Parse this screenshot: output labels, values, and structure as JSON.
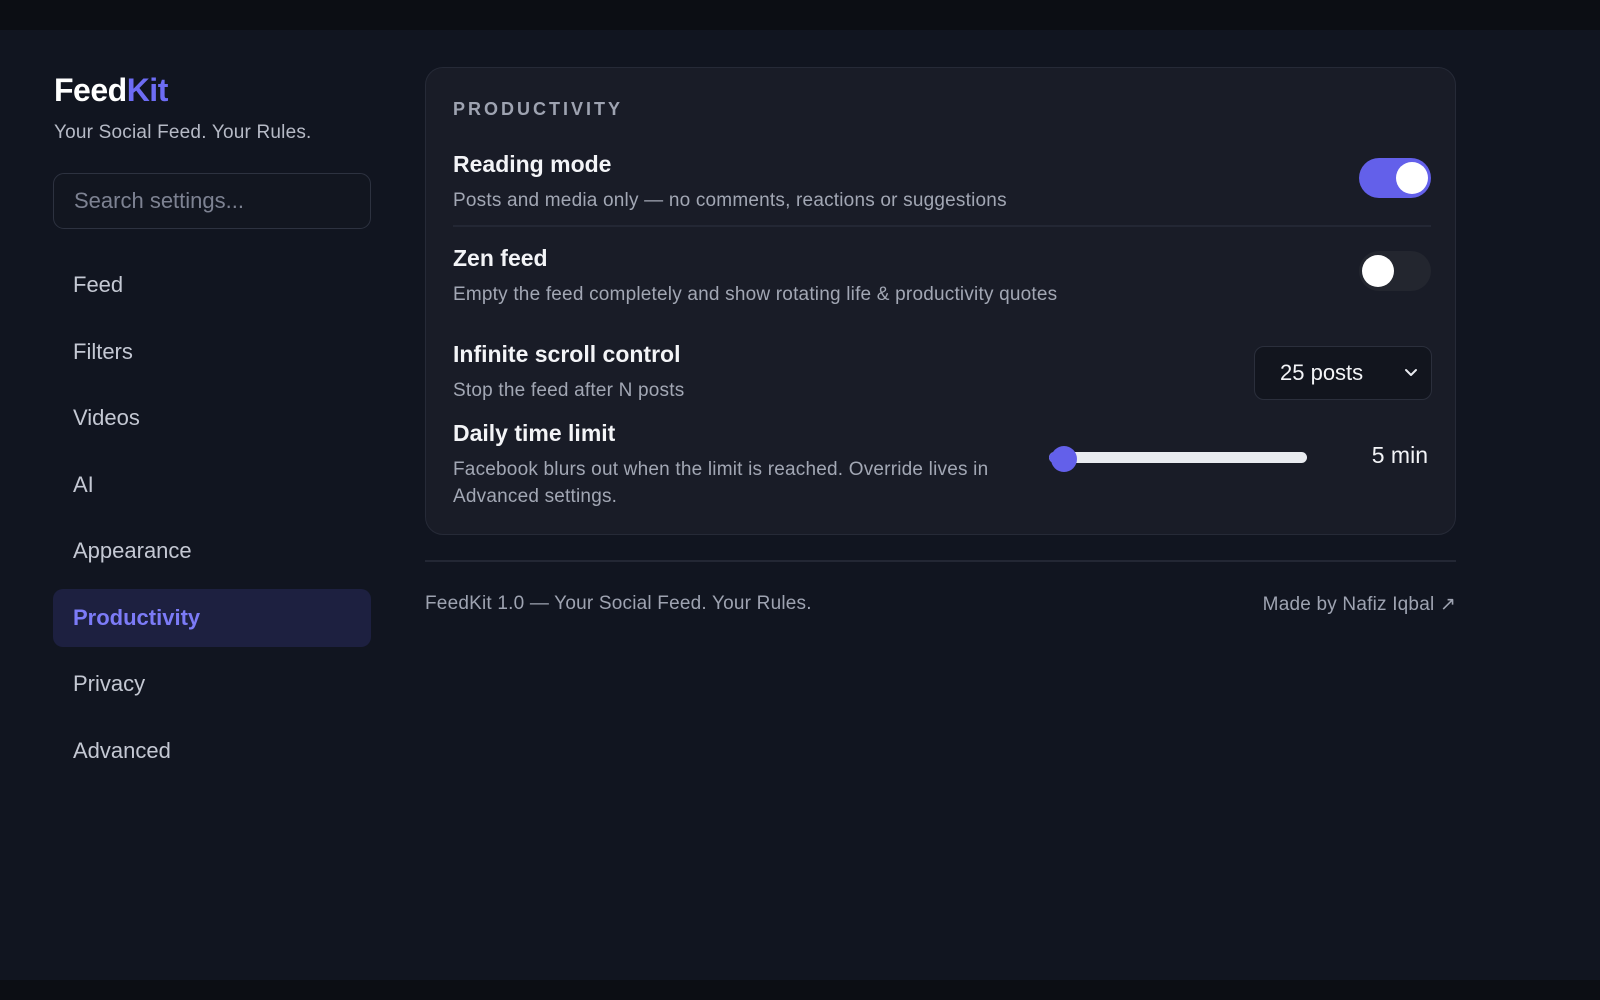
{
  "brand": {
    "name_part1": "Feed",
    "name_part2": "Kit",
    "tagline": "Your Social Feed. Your Rules."
  },
  "search": {
    "placeholder": "Search settings..."
  },
  "sidebar": {
    "items": [
      {
        "label": "Feed",
        "active": false
      },
      {
        "label": "Filters",
        "active": false
      },
      {
        "label": "Videos",
        "active": false
      },
      {
        "label": "AI",
        "active": false
      },
      {
        "label": "Appearance",
        "active": false
      },
      {
        "label": "Productivity",
        "active": true
      },
      {
        "label": "Privacy",
        "active": false
      },
      {
        "label": "Advanced",
        "active": false
      }
    ]
  },
  "section": {
    "title": "PRODUCTIVITY",
    "settings": {
      "reading_mode": {
        "title": "Reading mode",
        "description": "Posts and media only — no comments, reactions or suggestions",
        "enabled": true
      },
      "zen_feed": {
        "title": "Zen feed",
        "description": "Empty the feed completely and show rotating life & productivity quotes",
        "enabled": false
      },
      "infinite_scroll": {
        "title": "Infinite scroll control",
        "description": "Stop the feed after N posts",
        "selected": "25 posts"
      },
      "daily_limit": {
        "title": "Daily time limit",
        "description": "Facebook blurs out when the limit is reached. Override lives in Advanced settings.",
        "value_label": "5 min",
        "fraction": 0.02
      }
    }
  },
  "footer": {
    "left": "FeedKit 1.0 — Your Social Feed. Your Rules.",
    "right": "Made by Nafiz Iqbal ↗"
  },
  "colors": {
    "accent": "#6360ea",
    "background": "#111520",
    "card": "#191c27"
  }
}
